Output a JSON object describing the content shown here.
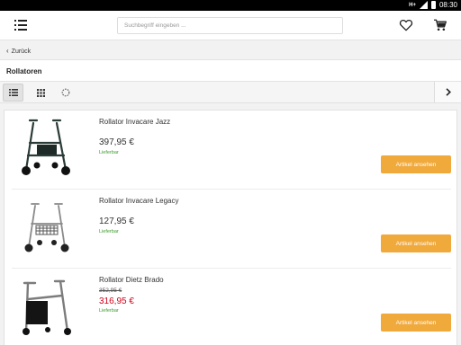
{
  "status_bar": {
    "network": "H+",
    "time": "08:30"
  },
  "header": {
    "search_placeholder": "Suchbegriff eingeben ...",
    "menu_icon": "hamburger-menu-icon",
    "wishlist_icon": "heart-icon",
    "cart_icon": "cart-icon"
  },
  "nav": {
    "back_label": "Zurück"
  },
  "category": {
    "title": "Rollatoren"
  },
  "view_toggle": {
    "options": [
      "list-view-icon",
      "grid-view-icon",
      "loading-icon"
    ],
    "selected": "list-view-icon",
    "next_icon": "chevron-right-icon"
  },
  "products": [
    {
      "name": "Rollator Invacare Jazz",
      "old_price": "",
      "price": "397,95 €",
      "availability": "Lieferbar",
      "button": "Artikel ansehen",
      "on_sale": false
    },
    {
      "name": "Rollator Invacare Legacy",
      "old_price": "",
      "price": "127,95 €",
      "availability": "Lieferbar",
      "button": "Artikel ansehen",
      "on_sale": false
    },
    {
      "name": "Rollator Dietz Brado",
      "old_price": "352,95 €",
      "price": "316,95 €",
      "availability": "Lieferbar",
      "button": "Artikel ansehen",
      "on_sale": true
    }
  ],
  "colors": {
    "accent_button": "#f0a93b",
    "sale_price": "#d0021b",
    "availability": "#3f9b30"
  }
}
